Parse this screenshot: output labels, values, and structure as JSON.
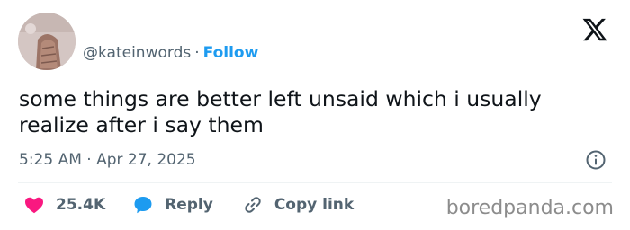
{
  "author": {
    "handle": "@katеinwords",
    "separator": "·",
    "follow_label": "Follow"
  },
  "tweet": {
    "text": "some things are better left unsaid which i usually realize after i say them",
    "time": "5:25 AM",
    "separator": "·",
    "date": "Apr 27, 2025"
  },
  "actions": {
    "likes": "25.4K",
    "reply_label": "Reply",
    "copy_link_label": "Copy link"
  },
  "watermark": "boredpanda.com",
  "colors": {
    "like": "#f91880",
    "reply": "#1d9bf0",
    "follow": "#1d9bf0",
    "muted": "#536471",
    "text": "#0f1419"
  },
  "icons": {
    "brand": "x-logo-icon",
    "info": "info-icon",
    "like": "heart-icon",
    "reply": "speech-bubble-icon",
    "copy_link": "link-icon"
  }
}
